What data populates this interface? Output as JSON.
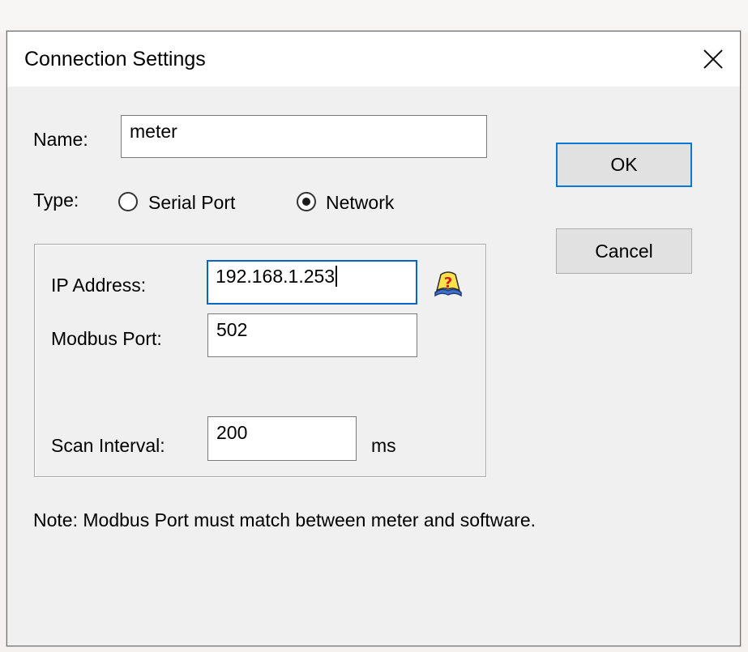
{
  "window": {
    "title": "Connection Settings"
  },
  "form": {
    "name_label": "Name:",
    "name_value": "meter",
    "type_label": "Type:",
    "type_options": [
      "Serial Port",
      "Network"
    ],
    "type_selected": "Network",
    "ip_label": "IP Address:",
    "ip_value": "192.168.1.253",
    "port_label": "Modbus Port:",
    "port_value": "502",
    "scan_label": "Scan Interval:",
    "scan_value": "200",
    "scan_unit": "ms"
  },
  "buttons": {
    "ok": "OK",
    "cancel": "Cancel"
  },
  "note": "Note:  Modbus Port must match between meter and software.",
  "icons": {
    "help": "help-book-icon",
    "close": "close-icon"
  }
}
